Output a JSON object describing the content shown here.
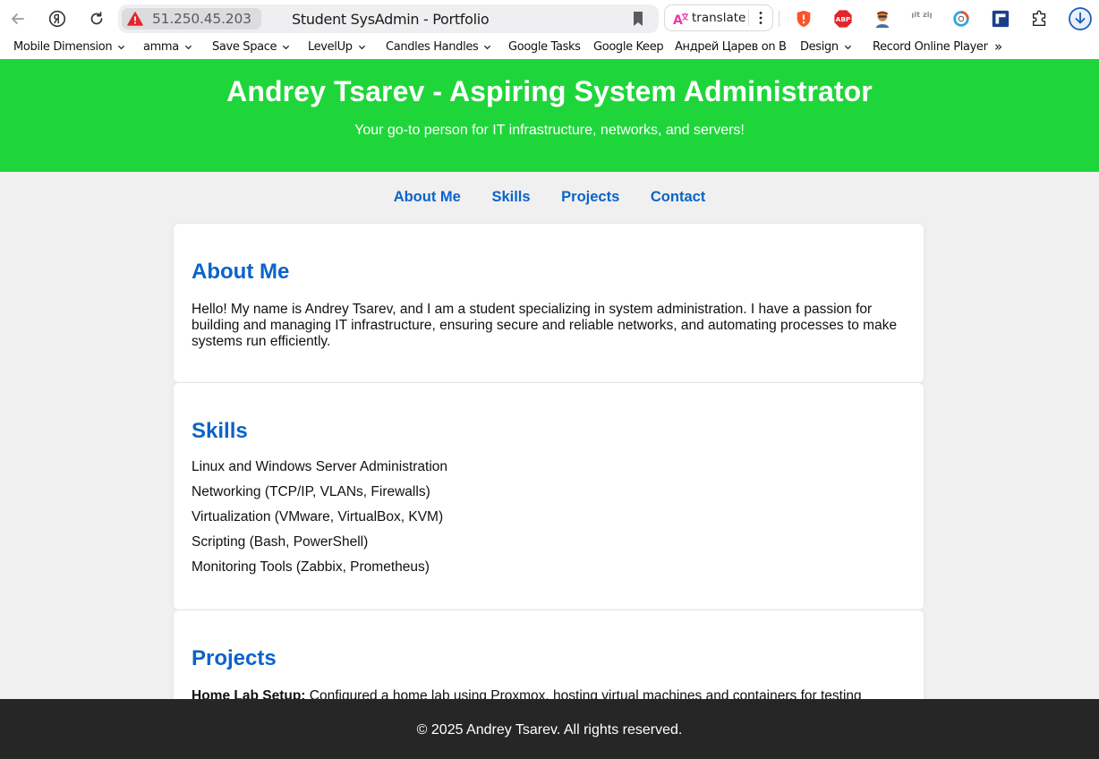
{
  "browser": {
    "url": "51.250.45.203",
    "tab_title": "Student SysAdmin - Portfolio",
    "translate_label": "translate",
    "bookmarks": [
      {
        "label": "Mobile Dimension",
        "has_menu": true
      },
      {
        "label": "amma",
        "has_menu": true
      },
      {
        "label": "Save Space",
        "has_menu": true
      },
      {
        "label": "LevelUp",
        "has_menu": true
      },
      {
        "label": "Candles Handles",
        "has_menu": true
      },
      {
        "label": "Google Tasks",
        "has_menu": false
      },
      {
        "label": "Google Keep",
        "has_menu": false
      },
      {
        "label": "Андрей Царев on Be",
        "has_menu": false
      },
      {
        "label": "Design",
        "has_menu": true
      },
      {
        "label": "Record Online Player",
        "has_menu": false
      }
    ],
    "bookmarks_overflow": "»",
    "extension_badges": {
      "abp": "ABP",
      "gitzip": "git zip"
    },
    "colors": {
      "warning": "#e5252c",
      "brave": "#fb542b",
      "abp": "#e4242b",
      "download": "#1a5fb4"
    }
  },
  "header": {
    "title": "Andrey Tsarev - Aspiring System Administrator",
    "subtitle": "Your go-to person for IT infrastructure, networks, and servers!"
  },
  "nav": {
    "links": [
      "About Me",
      "Skills",
      "Projects",
      "Contact"
    ]
  },
  "about": {
    "heading": "About Me",
    "text": "Hello! My name is Andrey Tsarev, and I am a student specializing in system administration. I have a passion for building and managing IT infrastructure, ensuring secure and reliable networks, and automating processes to make systems run efficiently."
  },
  "skills": {
    "heading": "Skills",
    "items": [
      "Linux and Windows Server Administration",
      "Networking (TCP/IP, VLANs, Firewalls)",
      "Virtualization (VMware, VirtualBox, KVM)",
      "Scripting (Bash, PowerShell)",
      "Monitoring Tools (Zabbix, Prometheus)"
    ]
  },
  "projects": {
    "heading": "Projects",
    "first_label": "Home Lab Setup:",
    "first_text": " Configured a home lab using Proxmox, hosting virtual machines and containers for testing"
  },
  "footer": {
    "text": "© 2025 Andrey Tsarev. All rights reserved."
  },
  "theme": {
    "hero_bg": "#1fd63a",
    "accent": "#0b63c8",
    "footer_bg": "#262626",
    "page_bg": "#f0f0f0"
  }
}
